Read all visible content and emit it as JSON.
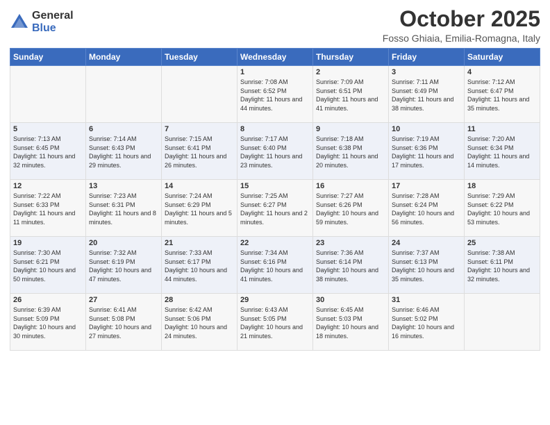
{
  "logo": {
    "general": "General",
    "blue": "Blue"
  },
  "header": {
    "month": "October 2025",
    "location": "Fosso Ghiaia, Emilia-Romagna, Italy"
  },
  "days_of_week": [
    "Sunday",
    "Monday",
    "Tuesday",
    "Wednesday",
    "Thursday",
    "Friday",
    "Saturday"
  ],
  "weeks": [
    [
      {
        "day": "",
        "content": ""
      },
      {
        "day": "",
        "content": ""
      },
      {
        "day": "",
        "content": ""
      },
      {
        "day": "1",
        "content": "Sunrise: 7:08 AM\nSunset: 6:52 PM\nDaylight: 11 hours and 44 minutes."
      },
      {
        "day": "2",
        "content": "Sunrise: 7:09 AM\nSunset: 6:51 PM\nDaylight: 11 hours and 41 minutes."
      },
      {
        "day": "3",
        "content": "Sunrise: 7:11 AM\nSunset: 6:49 PM\nDaylight: 11 hours and 38 minutes."
      },
      {
        "day": "4",
        "content": "Sunrise: 7:12 AM\nSunset: 6:47 PM\nDaylight: 11 hours and 35 minutes."
      }
    ],
    [
      {
        "day": "5",
        "content": "Sunrise: 7:13 AM\nSunset: 6:45 PM\nDaylight: 11 hours and 32 minutes."
      },
      {
        "day": "6",
        "content": "Sunrise: 7:14 AM\nSunset: 6:43 PM\nDaylight: 11 hours and 29 minutes."
      },
      {
        "day": "7",
        "content": "Sunrise: 7:15 AM\nSunset: 6:41 PM\nDaylight: 11 hours and 26 minutes."
      },
      {
        "day": "8",
        "content": "Sunrise: 7:17 AM\nSunset: 6:40 PM\nDaylight: 11 hours and 23 minutes."
      },
      {
        "day": "9",
        "content": "Sunrise: 7:18 AM\nSunset: 6:38 PM\nDaylight: 11 hours and 20 minutes."
      },
      {
        "day": "10",
        "content": "Sunrise: 7:19 AM\nSunset: 6:36 PM\nDaylight: 11 hours and 17 minutes."
      },
      {
        "day": "11",
        "content": "Sunrise: 7:20 AM\nSunset: 6:34 PM\nDaylight: 11 hours and 14 minutes."
      }
    ],
    [
      {
        "day": "12",
        "content": "Sunrise: 7:22 AM\nSunset: 6:33 PM\nDaylight: 11 hours and 11 minutes."
      },
      {
        "day": "13",
        "content": "Sunrise: 7:23 AM\nSunset: 6:31 PM\nDaylight: 11 hours and 8 minutes."
      },
      {
        "day": "14",
        "content": "Sunrise: 7:24 AM\nSunset: 6:29 PM\nDaylight: 11 hours and 5 minutes."
      },
      {
        "day": "15",
        "content": "Sunrise: 7:25 AM\nSunset: 6:27 PM\nDaylight: 11 hours and 2 minutes."
      },
      {
        "day": "16",
        "content": "Sunrise: 7:27 AM\nSunset: 6:26 PM\nDaylight: 10 hours and 59 minutes."
      },
      {
        "day": "17",
        "content": "Sunrise: 7:28 AM\nSunset: 6:24 PM\nDaylight: 10 hours and 56 minutes."
      },
      {
        "day": "18",
        "content": "Sunrise: 7:29 AM\nSunset: 6:22 PM\nDaylight: 10 hours and 53 minutes."
      }
    ],
    [
      {
        "day": "19",
        "content": "Sunrise: 7:30 AM\nSunset: 6:21 PM\nDaylight: 10 hours and 50 minutes."
      },
      {
        "day": "20",
        "content": "Sunrise: 7:32 AM\nSunset: 6:19 PM\nDaylight: 10 hours and 47 minutes."
      },
      {
        "day": "21",
        "content": "Sunrise: 7:33 AM\nSunset: 6:17 PM\nDaylight: 10 hours and 44 minutes."
      },
      {
        "day": "22",
        "content": "Sunrise: 7:34 AM\nSunset: 6:16 PM\nDaylight: 10 hours and 41 minutes."
      },
      {
        "day": "23",
        "content": "Sunrise: 7:36 AM\nSunset: 6:14 PM\nDaylight: 10 hours and 38 minutes."
      },
      {
        "day": "24",
        "content": "Sunrise: 7:37 AM\nSunset: 6:13 PM\nDaylight: 10 hours and 35 minutes."
      },
      {
        "day": "25",
        "content": "Sunrise: 7:38 AM\nSunset: 6:11 PM\nDaylight: 10 hours and 32 minutes."
      }
    ],
    [
      {
        "day": "26",
        "content": "Sunrise: 6:39 AM\nSunset: 5:09 PM\nDaylight: 10 hours and 30 minutes."
      },
      {
        "day": "27",
        "content": "Sunrise: 6:41 AM\nSunset: 5:08 PM\nDaylight: 10 hours and 27 minutes."
      },
      {
        "day": "28",
        "content": "Sunrise: 6:42 AM\nSunset: 5:06 PM\nDaylight: 10 hours and 24 minutes."
      },
      {
        "day": "29",
        "content": "Sunrise: 6:43 AM\nSunset: 5:05 PM\nDaylight: 10 hours and 21 minutes."
      },
      {
        "day": "30",
        "content": "Sunrise: 6:45 AM\nSunset: 5:03 PM\nDaylight: 10 hours and 18 minutes."
      },
      {
        "day": "31",
        "content": "Sunrise: 6:46 AM\nSunset: 5:02 PM\nDaylight: 10 hours and 16 minutes."
      },
      {
        "day": "",
        "content": ""
      }
    ]
  ]
}
